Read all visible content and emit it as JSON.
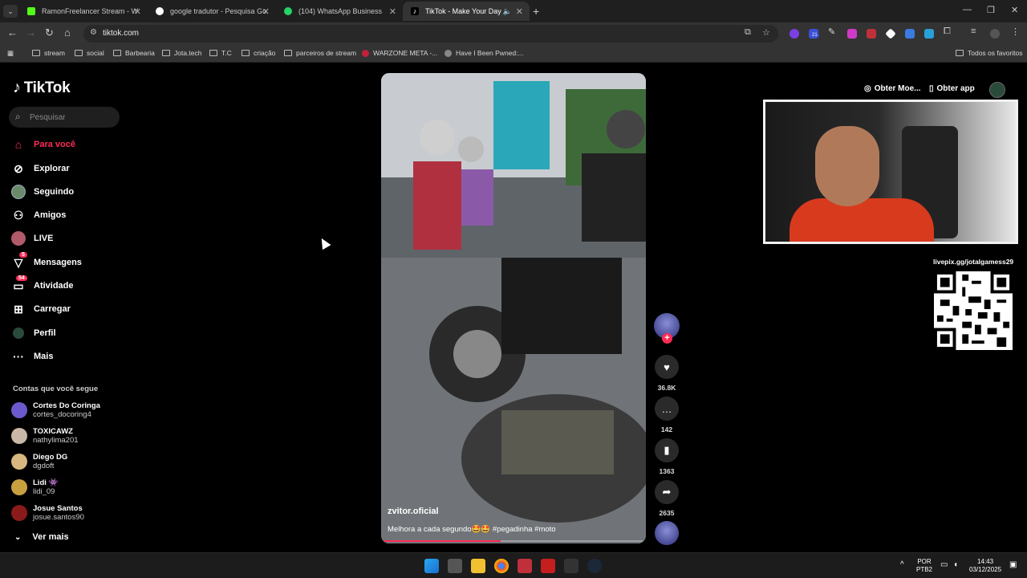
{
  "browser": {
    "tabs": [
      {
        "title": "RamonFreelancer Stream - Wa",
        "favicon_color": "#53fc18",
        "active": false
      },
      {
        "title": "google tradutor - Pesquisa Goo",
        "favicon_color": "#4285f4",
        "active": false
      },
      {
        "title": "(104) WhatsApp Business",
        "favicon_color": "#25d366",
        "active": false
      },
      {
        "title": "TikTok - Make Your Day",
        "favicon_color": "#000000",
        "active": true
      }
    ],
    "url": "tiktok.com",
    "extension_badge": "21",
    "bookmarks": [
      "stream",
      "social",
      "Barbearia",
      "Jota.tech",
      "T.C",
      "criação",
      "parceiros de stream",
      "WARZONE META -...",
      "Have I Been Pwned:..."
    ],
    "all_bookmarks": "Todos os favoritos"
  },
  "tiktok": {
    "logo": "TikTok",
    "search_placeholder": "Pesquisar",
    "menu": [
      {
        "label": "Para você",
        "icon": "home-icon",
        "active": true
      },
      {
        "label": "Explorar",
        "icon": "compass-icon"
      },
      {
        "label": "Seguindo",
        "icon": "following-avatar-icon"
      },
      {
        "label": "Amigos",
        "icon": "friends-icon"
      },
      {
        "label": "LIVE",
        "icon": "live-avatar-icon"
      },
      {
        "label": "Mensagens",
        "icon": "send-icon",
        "badge": "5"
      },
      {
        "label": "Atividade",
        "icon": "inbox-icon",
        "badge": "54"
      },
      {
        "label": "Carregar",
        "icon": "upload-icon"
      },
      {
        "label": "Perfil",
        "icon": "profile-avatar-icon"
      },
      {
        "label": "Mais",
        "icon": "more-icon"
      }
    ],
    "following_title": "Contas que você segue",
    "following": [
      {
        "name": "Cortes Do Coringa",
        "username": "cortes_docoring4",
        "color": "#6a5acd"
      },
      {
        "name": "TOXICAWZ",
        "username": "nathylima201",
        "color": "#c9b8a8"
      },
      {
        "name": "Diego DG",
        "username": "dgdoft",
        "color": "#d8b880"
      },
      {
        "name": "Lidi 👾",
        "username": "lidi_09",
        "color": "#c8a040"
      },
      {
        "name": "Josue Santos",
        "username": "josue.santos90",
        "color": "#8b1a1a"
      }
    ],
    "see_more": "Ver mais",
    "top_buttons": {
      "coins": "Obter Moe...",
      "app": "Obter app"
    },
    "video": {
      "author": "zvitor.oficial",
      "caption": "Melhora a cada segundo🤩🤩 #pegadinha #moto",
      "progress": 0.45
    },
    "actions": [
      {
        "name": "like",
        "icon": "heart-icon",
        "count": "36.8K"
      },
      {
        "name": "comment",
        "icon": "comment-icon",
        "count": "142"
      },
      {
        "name": "save",
        "icon": "bookmark-icon",
        "count": "1363"
      },
      {
        "name": "share",
        "icon": "share-icon",
        "count": "2635"
      }
    ]
  },
  "overlay": {
    "livepix": "livepix.gg/jotalgamess29"
  },
  "taskbar": {
    "lang": "POR",
    "layout": "PTB2",
    "time": "14:43",
    "date": "03/12/2025"
  }
}
